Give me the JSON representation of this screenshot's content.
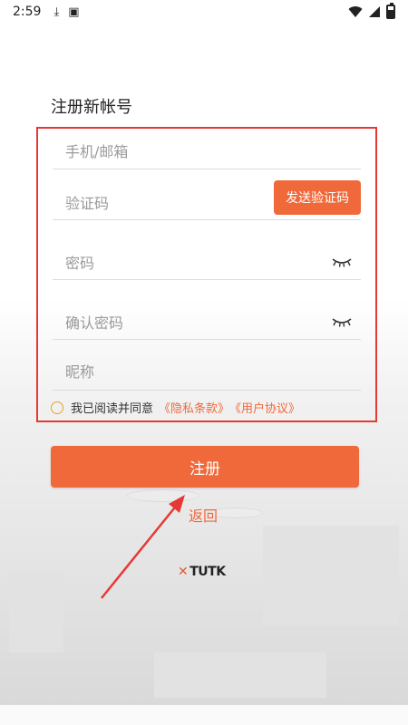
{
  "status_bar": {
    "time": "2:59",
    "icons": [
      "download-icon",
      "a-icon"
    ],
    "right_icons": [
      "wifi-icon",
      "signal-icon",
      "battery-icon"
    ]
  },
  "page": {
    "title": "注册新帐号"
  },
  "form": {
    "phone_placeholder": "手机/邮箱",
    "code_placeholder": "验证码",
    "send_code_label": "发送验证码",
    "password_placeholder": "密码",
    "confirm_password_placeholder": "确认密码",
    "nickname_placeholder": "昵称",
    "agree_text": "我已阅读并同意",
    "privacy_link": "《隐私条款》",
    "user_agreement_link": "《用户协议》"
  },
  "actions": {
    "register_label": "注册",
    "back_label": "返回"
  },
  "brand": {
    "logo_text": "TUTK"
  },
  "colors": {
    "accent": "#f0693a",
    "highlight_border": "#e53935"
  }
}
